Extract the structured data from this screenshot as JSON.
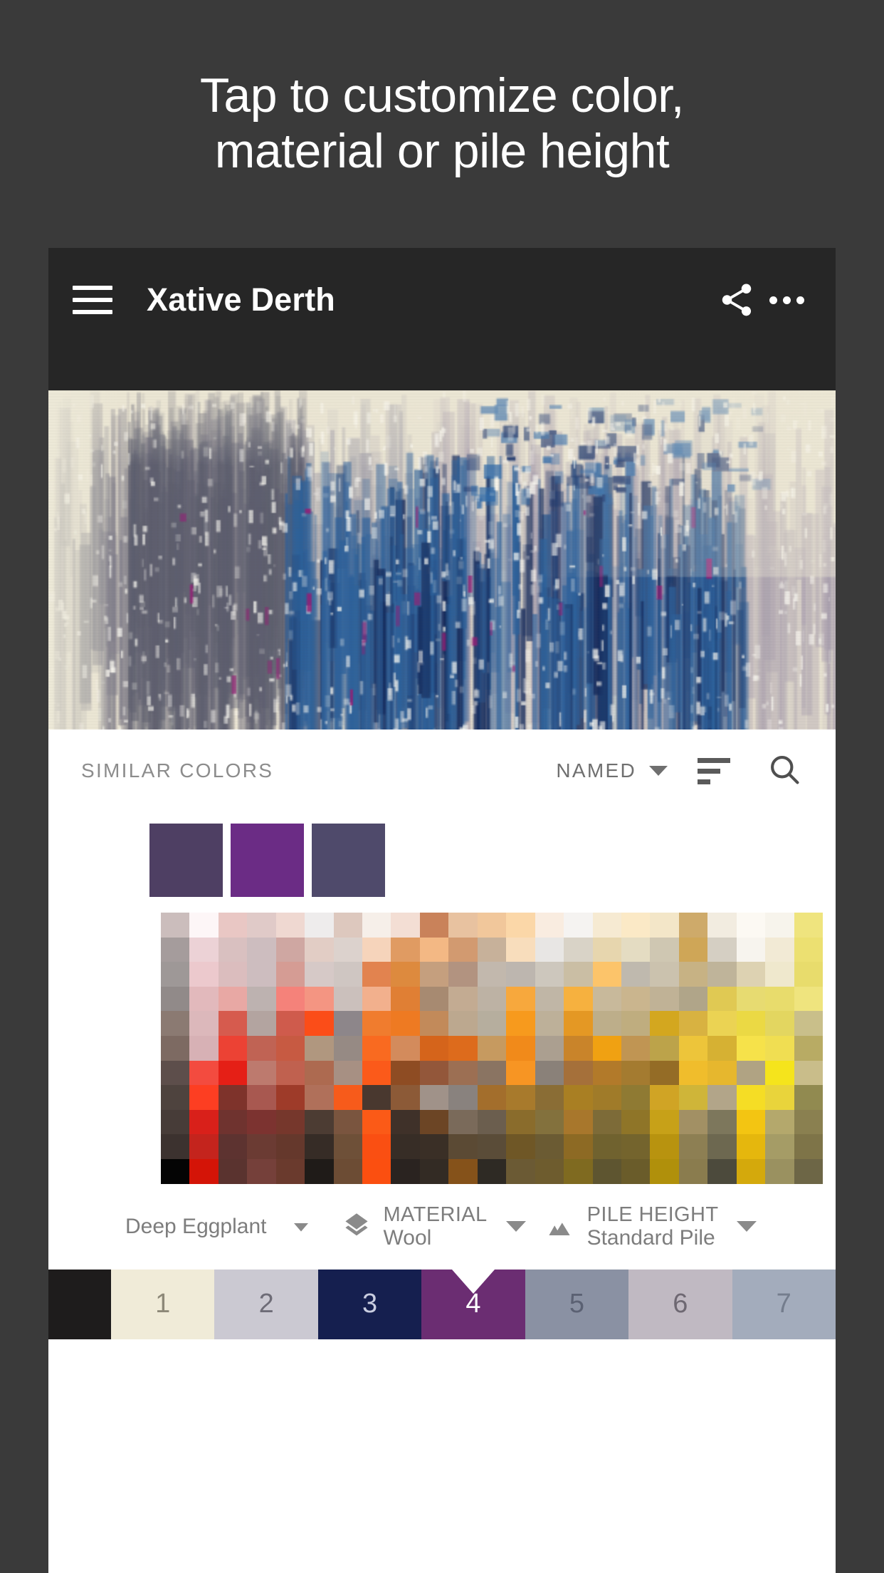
{
  "headline": {
    "line1": "Tap to customize color,",
    "line2": "material or pile height"
  },
  "appbar": {
    "menu_icon": "hamburger-menu-icon",
    "title": "Xative Derth",
    "share_icon": "share-icon",
    "overflow_icon": "more-options-icon",
    "background": "#262626"
  },
  "rug": {
    "alt": "abstract blue grey cream rug texture",
    "base_color": "#ece6d4",
    "accent_colors": [
      "#9d96a8",
      "#2f5f98",
      "#1b3566",
      "#8f2f7e"
    ]
  },
  "similar_colors": {
    "title": "SIMILAR COLORS",
    "sort_value": "NAMED",
    "sort_caret_icon": "chevron-down-icon",
    "sort_list_icon": "sort-icon",
    "search_icon": "search-icon",
    "swatches": [
      {
        "name": "swatch-1",
        "color": "#4E3F63"
      },
      {
        "name": "swatch-2",
        "color": "#6B2C85"
      },
      {
        "name": "swatch-3",
        "color": "#4F4A6B"
      }
    ]
  },
  "options": {
    "color_name": "Deep Eggplant",
    "color_caret_icon": "chevron-down-icon",
    "material": {
      "icon": "layers-icon",
      "label": "MATERIAL",
      "value": "Wool",
      "caret_icon": "chevron-down-icon"
    },
    "pile_height": {
      "icon": "mountain-icon",
      "label": "PILE HEIGHT",
      "value": "Standard Pile",
      "caret_icon": "chevron-down-icon"
    }
  },
  "bottom_strip": {
    "selected_index": 4,
    "marker_icon": "selected-marker-triangle",
    "cells": [
      {
        "label": "",
        "color": "#1E1C1C",
        "text_color": "#ffffff"
      },
      {
        "label": "1",
        "color": "#F0EBD8",
        "text_color": "#8d8878"
      },
      {
        "label": "2",
        "color": "#CBC9D2",
        "text_color": "#6e6c77"
      },
      {
        "label": "3",
        "color": "#151F4F",
        "text_color": "#c9cde0"
      },
      {
        "label": "4",
        "color": "#6B2D72",
        "text_color": "#ffffff"
      },
      {
        "label": "5",
        "color": "#8A91A3",
        "text_color": "#5b6173"
      },
      {
        "label": "6",
        "color": "#C0B9C2",
        "text_color": "#6e6872"
      },
      {
        "label": "7",
        "color": "#A3ACBC",
        "text_color": "#747d8d"
      }
    ]
  },
  "chart_data": {
    "type": "heatmap",
    "title": "",
    "rows": 11,
    "cols": 23,
    "note": "color palette grid of similar colors",
    "grid": [
      [
        "#cbbdbc",
        "#fdf6f7",
        "#e9c7c4",
        "#e0cac8",
        "#efd8d1",
        "#eeecec",
        "#ddc8be",
        "#f6efe9",
        "#f3ded4",
        "#c9825a",
        "#e8c2a0",
        "#f1c79b",
        "#fbd7a8",
        "#f9ece0",
        "#f5f3f1",
        "#f6ead2",
        "#fbe9c6",
        "#f3e6c8",
        "#ceaa6a",
        "#f2ece0",
        "#fcf9f3",
        "#f7f4ec",
        "#efe47e"
      ],
      [
        "#a59c9c",
        "#ecd2d6",
        "#d9c0c0",
        "#cdbdbf",
        "#cfa7a2",
        "#e2cdc5",
        "#dcd2cd",
        "#f6d4bb",
        "#e09b62",
        "#f3b884",
        "#d29a70",
        "#c7b19a",
        "#f8ddbc",
        "#e8e6e4",
        "#d9d3c7",
        "#e7d6ae",
        "#e4dcc2",
        "#cfc7b2",
        "#cfa657",
        "#d5cfc3",
        "#f7f4ee",
        "#f2ead5",
        "#ece071"
      ],
      [
        "#9e9897",
        "#ecc9cd",
        "#dbbdbe",
        "#cdbdbf",
        "#d59c94",
        "#d6c9c7",
        "#cfc6c2",
        "#e2834f",
        "#dd8a3e",
        "#c59f7e",
        "#b29380",
        "#c2b8ad",
        "#bdb6af",
        "#cdc7bd",
        "#cabea4",
        "#fcc46a",
        "#bfb9ae",
        "#cbc2ae",
        "#c7b284",
        "#bfb49a",
        "#ddd2b2",
        "#efe8cd",
        "#e8dc6c"
      ],
      [
        "#918a89",
        "#e2b9bc",
        "#e8a8a4",
        "#bdb2b0",
        "#f5827a",
        "#f49582",
        "#cbc0bc",
        "#f2b08d",
        "#e07f34",
        "#a78a71",
        "#c3ab92",
        "#bdb2a4",
        "#f7a83d",
        "#c0b6a6",
        "#f6b13f",
        "#c8b99b",
        "#cab58e",
        "#c0b296",
        "#b0a589",
        "#e0c953",
        "#e7db71",
        "#e8dc6c",
        "#efe47e"
      ],
      [
        "#8b7a72",
        "#dcb8bb",
        "#d65b4e",
        "#b3a4a0",
        "#cf5b4c",
        "#fb4d18",
        "#8d868a",
        "#f07c2e",
        "#ee7a22",
        "#c28a5a",
        "#bca88f",
        "#b6ae9e",
        "#f79a1d",
        "#bdb099",
        "#e49824",
        "#bdae8a",
        "#bfad7f",
        "#d3a71f",
        "#d8b241",
        "#ebd353",
        "#ebd944",
        "#e3d660",
        "#c9bf8a"
      ],
      [
        "#7d6a62",
        "#d7b1b5",
        "#ec4234",
        "#c06354",
        "#c75a42",
        "#b0977f",
        "#968a84",
        "#f96a20",
        "#d38b5c",
        "#d5641b",
        "#dd6b1c",
        "#c69a60",
        "#f18a1a",
        "#ab9f90",
        "#c9842a",
        "#f0a112",
        "#c09553",
        "#bca34a",
        "#edc53a",
        "#d6b133",
        "#f6e24a",
        "#f0de52",
        "#b8ab64"
      ],
      [
        "#5d4e4b",
        "#f34b3f",
        "#e51f16",
        "#bd7a6e",
        "#c0614f",
        "#ad6a50",
        "#a79083",
        "#fb5a1a",
        "#8e4c23",
        "#93573a",
        "#9c6f53",
        "#8a7462",
        "#f79523",
        "#8a8179",
        "#a5703a",
        "#b27a2a",
        "#a47b30",
        "#946c26",
        "#f0bd2c",
        "#e6b72e",
        "#b0a383",
        "#f5e41c",
        "#c9bd8a"
      ],
      [
        "#4e433e",
        "#fd3e22",
        "#7e332b",
        "#a85850",
        "#9e3b29",
        "#b0705a",
        "#f75b1b",
        "#49382f",
        "#8c5a37",
        "#a09289",
        "#89827e",
        "#a36e2c",
        "#a87a2c",
        "#8a6d35",
        "#a97f23",
        "#a07b29",
        "#8f7a33",
        "#d0a425",
        "#cfb539",
        "#b2a589",
        "#f5dd25",
        "#e9d43b",
        "#918a50"
      ],
      [
        "#473c38",
        "#d9201a",
        "#6f332f",
        "#7c3330",
        "#76372c",
        "#4c3c33",
        "#7a553f",
        "#fb5a17",
        "#3f3129",
        "#6c4525",
        "#7a6a5a",
        "#6b5e4e",
        "#8a6c2c",
        "#83713d",
        "#a8772c",
        "#7d6b38",
        "#8f7528",
        "#c7a118",
        "#a29064",
        "#7d775c",
        "#f3c512",
        "#b4a86c",
        "#8a8050"
      ],
      [
        "#3c322f",
        "#c4241d",
        "#5d3330",
        "#6b3b33",
        "#65382c",
        "#362c26",
        "#6e5038",
        "#fa4f12",
        "#372d26",
        "#3a2f26",
        "#5b4a34",
        "#5a4c38",
        "#6f5726",
        "#6b5b33",
        "#8d6a24",
        "#70622f",
        "#74642d",
        "#b8930f",
        "#8d7f53",
        "#6d6850",
        "#e5b70d",
        "#a59c66",
        "#7e7448"
      ],
      [
        "#040404",
        "#d41407",
        "#5a332f",
        "#75403a",
        "#6a3a2d",
        "#1f1b18",
        "#6c4c34",
        "#fb4f10",
        "#2a2320",
        "#332b24",
        "#85521a",
        "#2e2a24",
        "#6b5a34",
        "#6e5c2e",
        "#7f6a20",
        "#5e5530",
        "#6a5c2a",
        "#b0900b",
        "#8a7c4e",
        "#4c4a3c",
        "#d4a90c",
        "#9a9160",
        "#6d6646"
      ]
    ]
  }
}
